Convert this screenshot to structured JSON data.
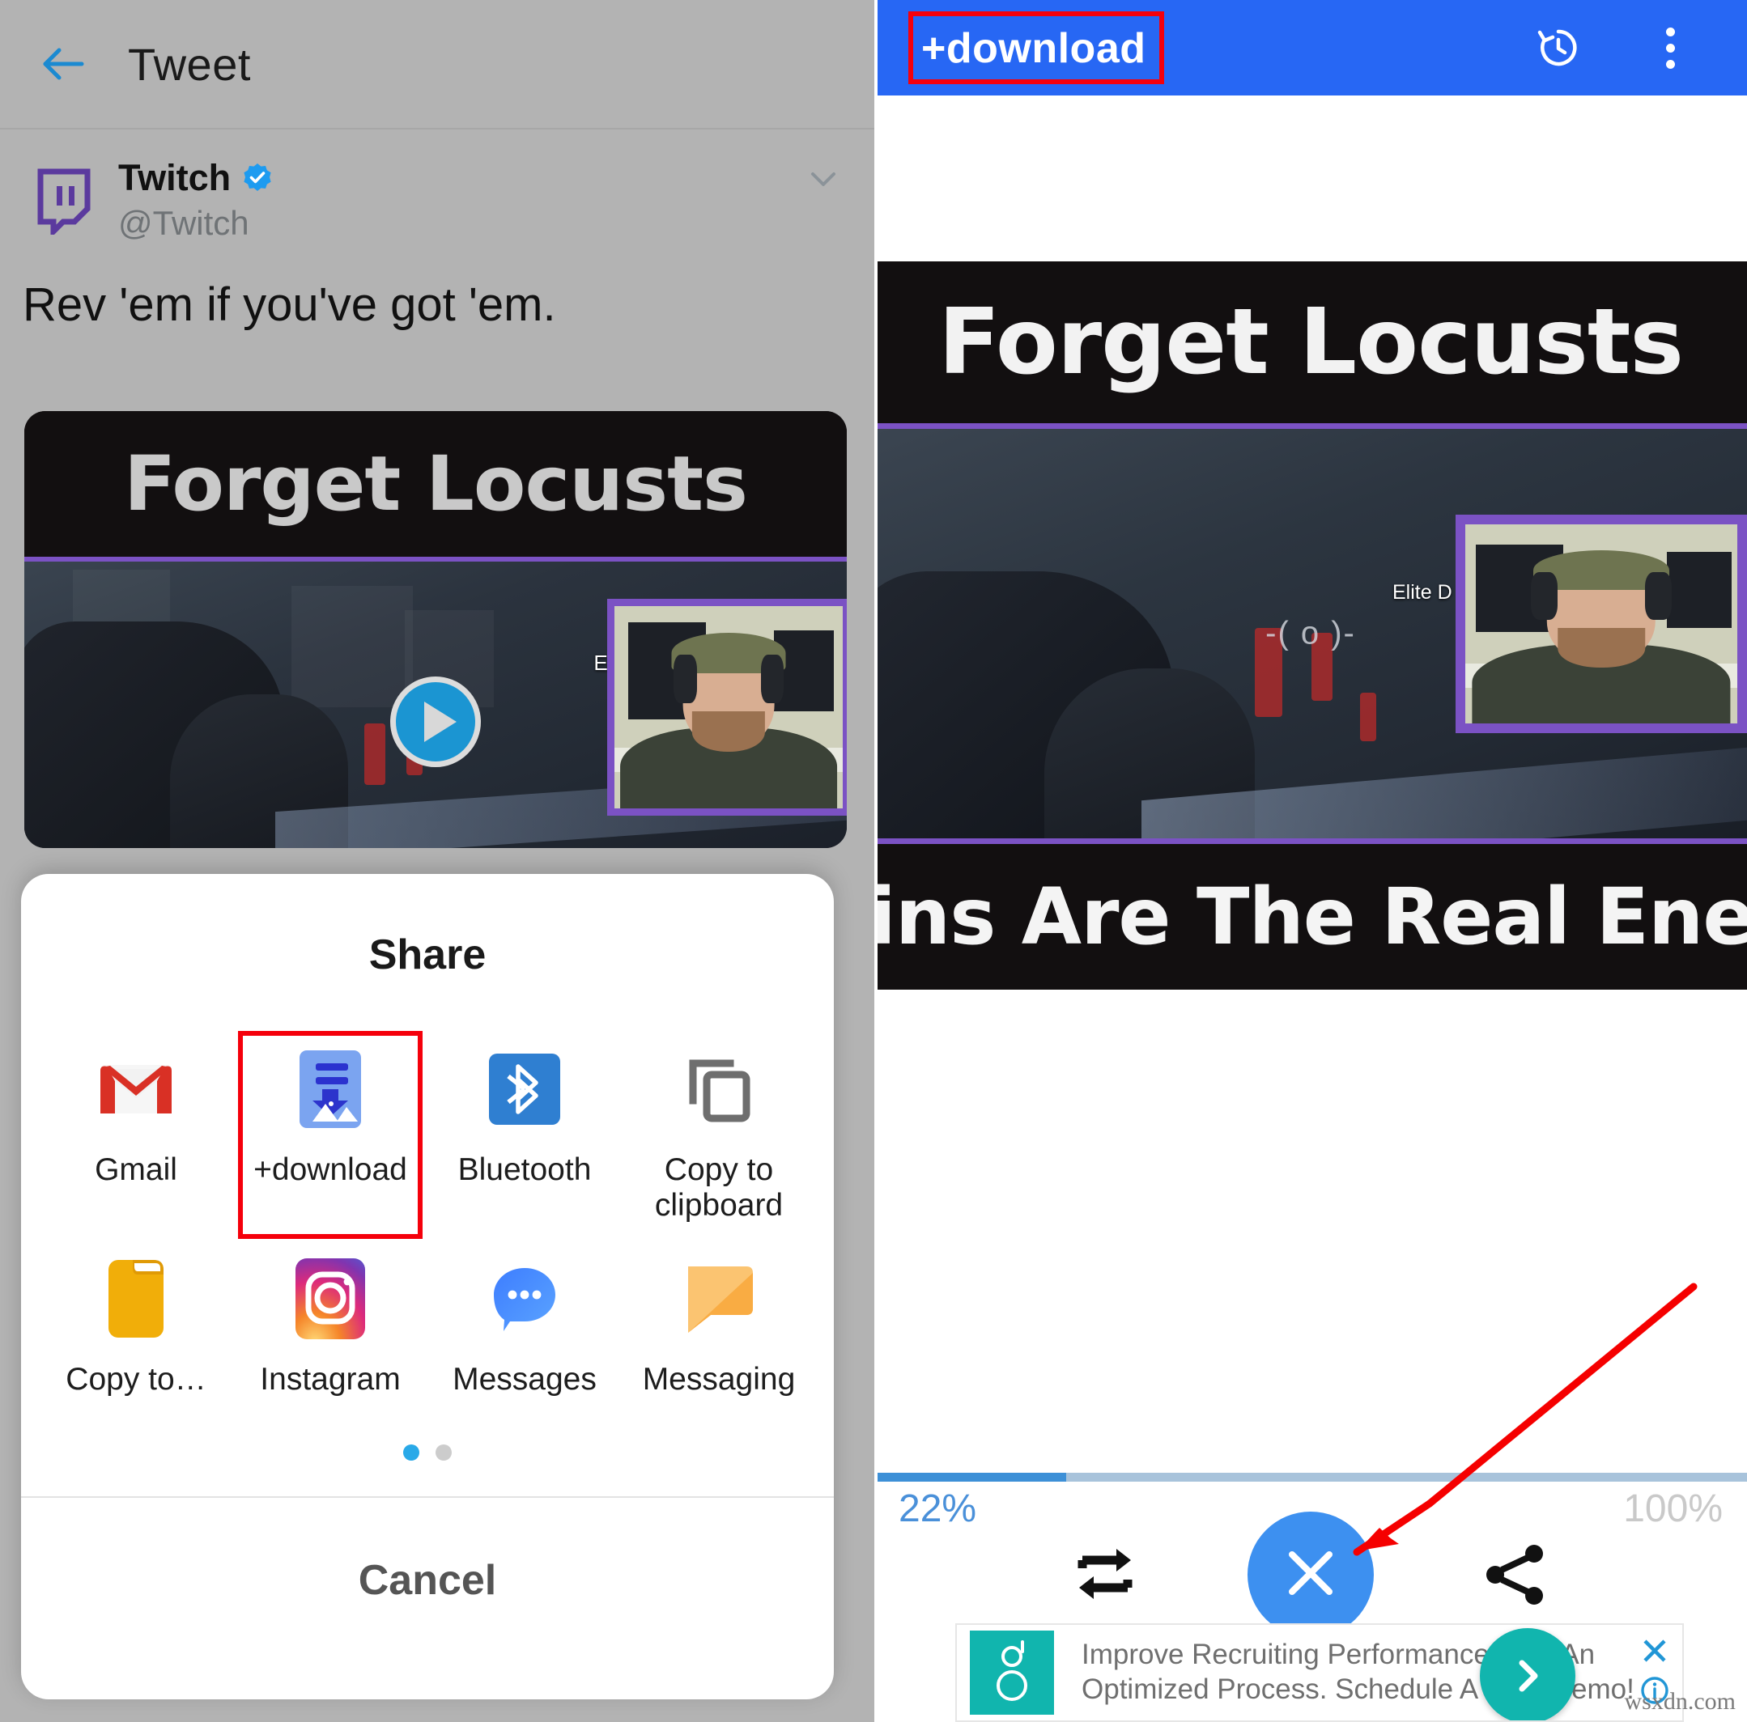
{
  "left": {
    "appbar": {
      "title": "Tweet",
      "back_icon": "back-arrow-icon"
    },
    "tweet": {
      "display_name": "Twitch",
      "handle": "@Twitch",
      "verified_icon": "verified-badge-icon",
      "avatar_icon": "twitch-logo-icon",
      "more_icon": "chevron-down-icon",
      "body": "Rev 'em if you've got 'em.",
      "media": {
        "caption_top": "Forget Locusts",
        "overlay_label": "Elite D",
        "play_icon": "play-button-icon"
      }
    },
    "share_sheet": {
      "title": "Share",
      "cancel_label": "Cancel",
      "page_dots": 2,
      "active_dot": 1,
      "apps": [
        {
          "label": "Gmail",
          "icon": "gmail-icon",
          "highlighted": false
        },
        {
          "label": "+download",
          "icon": "plus-download-icon",
          "highlighted": true
        },
        {
          "label": "Bluetooth",
          "icon": "bluetooth-icon",
          "highlighted": false
        },
        {
          "label": "Copy to clipboard",
          "icon": "copy-clipboard-icon",
          "highlighted": false
        },
        {
          "label": "Copy to…",
          "icon": "folder-icon",
          "highlighted": false
        },
        {
          "label": "Instagram",
          "icon": "instagram-icon",
          "highlighted": false
        },
        {
          "label": "Messages",
          "icon": "messages-bubble-icon",
          "highlighted": false
        },
        {
          "label": "Messaging",
          "icon": "messaging-bubble-icon",
          "highlighted": false
        }
      ]
    }
  },
  "right": {
    "appbar": {
      "title": "+download",
      "title_highlighted": true,
      "history_icon": "history-clock-icon",
      "overflow_icon": "kebab-menu-icon"
    },
    "media": {
      "caption_top": "Forget Locusts",
      "caption_bottom": "Trains Are The Real Enemy",
      "overlay_label": "Elite D"
    },
    "download": {
      "progress_percent": 22,
      "progress_label": "22%",
      "total_label": "100%",
      "buttons": [
        {
          "name": "retry-button",
          "icon": "repeat-arrows-icon"
        },
        {
          "name": "cancel-button",
          "icon": "close-x-icon"
        },
        {
          "name": "share-button",
          "icon": "share-nodes-icon"
        }
      ]
    },
    "ad": {
      "text": "Improve Recruiting Performance With An Optimized Process. Schedule A Free Demo!",
      "cta_icon": "chevron-right-icon",
      "close_icon": "close-x-icon",
      "info_icon": "info-circle-icon",
      "logo_icon": "advertiser-logo-icon"
    }
  },
  "annotations": {
    "arrow_icon": "red-arrow-icon",
    "highlight_color": "#f5000b"
  },
  "watermark": "wsxdn.com",
  "colors": {
    "twitter_chrome": "#b3b3b3",
    "download_blue": "#2767f4",
    "progress_blue": "#3d90d7",
    "twitch_purple": "#7b52c4",
    "ad_teal": "#11b5ae"
  }
}
